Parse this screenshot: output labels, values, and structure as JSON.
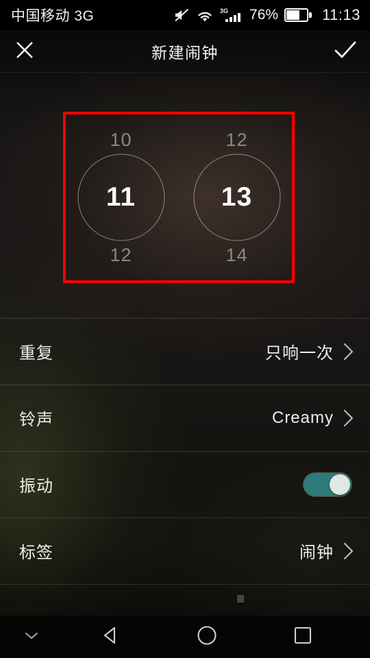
{
  "status_bar": {
    "carrier": "中国移动 3G",
    "icons": [
      "mute-icon",
      "wifi-icon",
      "signal-3g-icon"
    ],
    "network_label": "3G",
    "battery_percent": "76%",
    "battery_level": 0.66,
    "clock": "11:13"
  },
  "title_bar": {
    "close_icon": "close-icon",
    "title": "新建闹钟",
    "confirm_icon": "check-icon"
  },
  "time_picker": {
    "highlight_color": "#fe0000",
    "hour": {
      "previous": "10",
      "selected": "11",
      "next": "12"
    },
    "minute": {
      "previous": "12",
      "selected": "13",
      "next": "14"
    }
  },
  "settings": {
    "rows": [
      {
        "label": "重复",
        "value": "只响一次",
        "control": "chevron"
      },
      {
        "label": "铃声",
        "value": "Creamy",
        "control": "chevron"
      },
      {
        "label": "振动",
        "value": "",
        "control": "toggle",
        "toggle_on": true
      },
      {
        "label": "标签",
        "value": "闹钟",
        "control": "chevron"
      }
    ]
  },
  "nav_bar": {
    "hide_icon": "chevron-down-icon",
    "back_icon": "back-triangle-icon",
    "home_icon": "home-circle-icon",
    "recents_icon": "recents-square-icon"
  },
  "colors": {
    "toggle_on": "#2c7a79",
    "toggle_knob": "#dfe8e3",
    "highlight": "#fe0000",
    "text_primary": "#ededed",
    "text_dim": "#8d8880"
  }
}
